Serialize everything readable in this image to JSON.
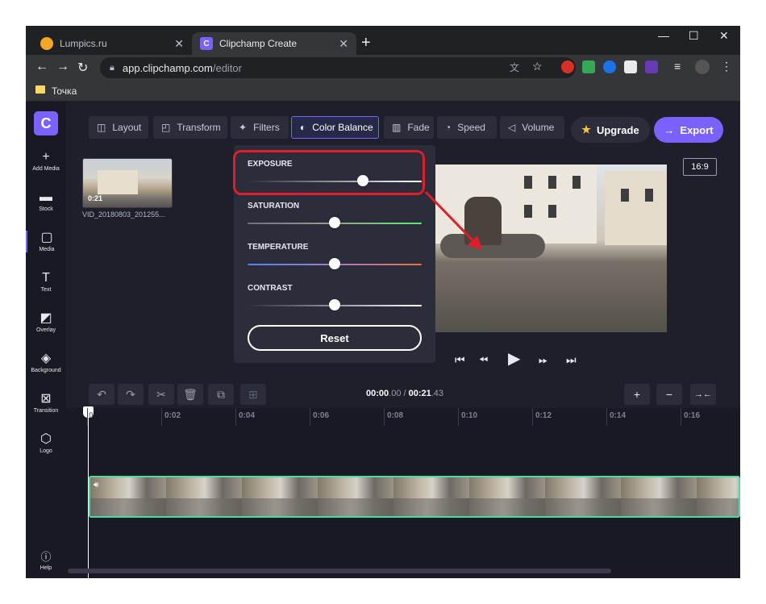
{
  "browser": {
    "tabs": [
      {
        "title": "Lumpics.ru",
        "active": false,
        "favicon_color": "#f5a623"
      },
      {
        "title": "Clipchamp Create",
        "active": true,
        "favicon_color": "#7b61ff",
        "favicon_letter": "C"
      }
    ],
    "new_tab_icon": "plus-icon",
    "url_host": "app.clipchamp.com",
    "url_path": "/editor",
    "bookmark": "Точка",
    "window_controls": [
      "minimize-icon",
      "maximize-icon",
      "close-icon"
    ]
  },
  "app": {
    "logo_letter": "C",
    "accent_color": "#7b61ff",
    "sidebar": [
      {
        "icon": "plus-icon",
        "glyph": "+",
        "label": "Add Media"
      },
      {
        "icon": "stock-icon",
        "glyph": "▬",
        "label": "Stock"
      },
      {
        "icon": "media-icon",
        "glyph": "▢",
        "label": "Media"
      },
      {
        "icon": "text-icon",
        "glyph": "T",
        "label": "Text"
      },
      {
        "icon": "overlay-icon",
        "glyph": "◩",
        "label": "Overlay"
      },
      {
        "icon": "background-icon",
        "glyph": "◈",
        "label": "Background"
      },
      {
        "icon": "transition-icon",
        "glyph": "⊠",
        "label": "Transition"
      },
      {
        "icon": "logo-icon",
        "glyph": "⬡",
        "label": "Logo"
      }
    ],
    "help_label": "Help",
    "toolbar": [
      {
        "label": "Layout",
        "icon": "layout-icon",
        "glyph": "◫"
      },
      {
        "label": "Transform",
        "icon": "transform-icon",
        "glyph": "◰"
      },
      {
        "label": "Filters",
        "icon": "filters-icon",
        "glyph": "✦"
      },
      {
        "label": "Color Balance",
        "icon": "color-balance-icon",
        "glyph": "◐",
        "active": true
      },
      {
        "label": "Fade",
        "icon": "fade-icon",
        "glyph": "▥"
      },
      {
        "label": "Speed",
        "icon": "speed-icon",
        "glyph": "◔"
      },
      {
        "label": "Volume",
        "icon": "volume-icon",
        "glyph": "◁"
      }
    ],
    "upgrade_label": "Upgrade",
    "export_label": "Export",
    "aspect_ratio": "16:9",
    "media": {
      "clip_name": "VID_20180803_201255...",
      "duration": "0:21"
    },
    "color_balance": {
      "sliders": [
        {
          "label": "EXPOSURE",
          "value": 0.66,
          "track": "exposure"
        },
        {
          "label": "SATURATION",
          "value": 0.5,
          "track": "saturation"
        },
        {
          "label": "TEMPERATURE",
          "value": 0.5,
          "track": "temperature"
        },
        {
          "label": "CONTRAST",
          "value": 0.5,
          "track": "contrast"
        }
      ],
      "reset_label": "Reset"
    },
    "timeline": {
      "current_time_main": "00:00",
      "current_time_frac": ".00",
      "separator": " / ",
      "total_time_main": "00:21",
      "total_time_frac": ".43",
      "ticks": [
        "0",
        "0:02",
        "0:04",
        "0:06",
        "0:08",
        "0:10",
        "0:12",
        "0:14",
        "0:16"
      ]
    }
  }
}
